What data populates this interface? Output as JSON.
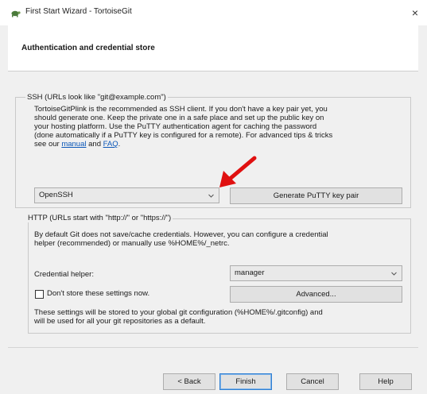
{
  "window": {
    "title": "First Start Wizard - TortoiseGit",
    "close_glyph": "×",
    "icon": "tortoisegit-logo-icon"
  },
  "header": {
    "title": "Authentication and credential store"
  },
  "ssh": {
    "legend": "SSH (URLs look like \"git@example.com\")",
    "line1": "TortoiseGitPlink is the recommended as SSH client. If you don't have a key pair yet, you",
    "line2": "should generate one. Keep the private one in a safe place and set up the public key on",
    "line3": "your hosting platform. Use the PuTTY authentication agent for caching the password",
    "line4": "(done automatically if a PuTTY key is configured for a remote). For advanced tips & tricks",
    "line5_prefix": "see our ",
    "manual_link": "manual",
    "line5_and": " and ",
    "faq_link": "FAQ",
    "line5_suffix": ".",
    "client_selected": "OpenSSH",
    "generate_button": "Generate PuTTY  key pair"
  },
  "http": {
    "legend": "HTTP (URLs start with \"http://\" or \"https://\")",
    "line1": "By default Git does not save/cache credentials. However, you can configure a credential",
    "line2": "helper (recommended) or manually use %HOME%/_netrc.",
    "credential_helper_label": "Credential helper:",
    "credential_helper_selected": "manager",
    "dont_store_label": "Don't store these settings now.",
    "dont_store_checked": false,
    "advanced_button": "Advanced...",
    "note_line1": "These settings will be stored to your global git configuration (%HOME%/.gitconfig) and",
    "note_line2": "will be used for all your git repositories as a default."
  },
  "footer": {
    "back_button": "< Back",
    "finish_button": "Finish",
    "cancel_button": "Cancel",
    "help_button": "Help"
  },
  "colors": {
    "link": "#0b57b8",
    "arrow": "#e01010",
    "default_button_border": "#2f7fd3"
  }
}
